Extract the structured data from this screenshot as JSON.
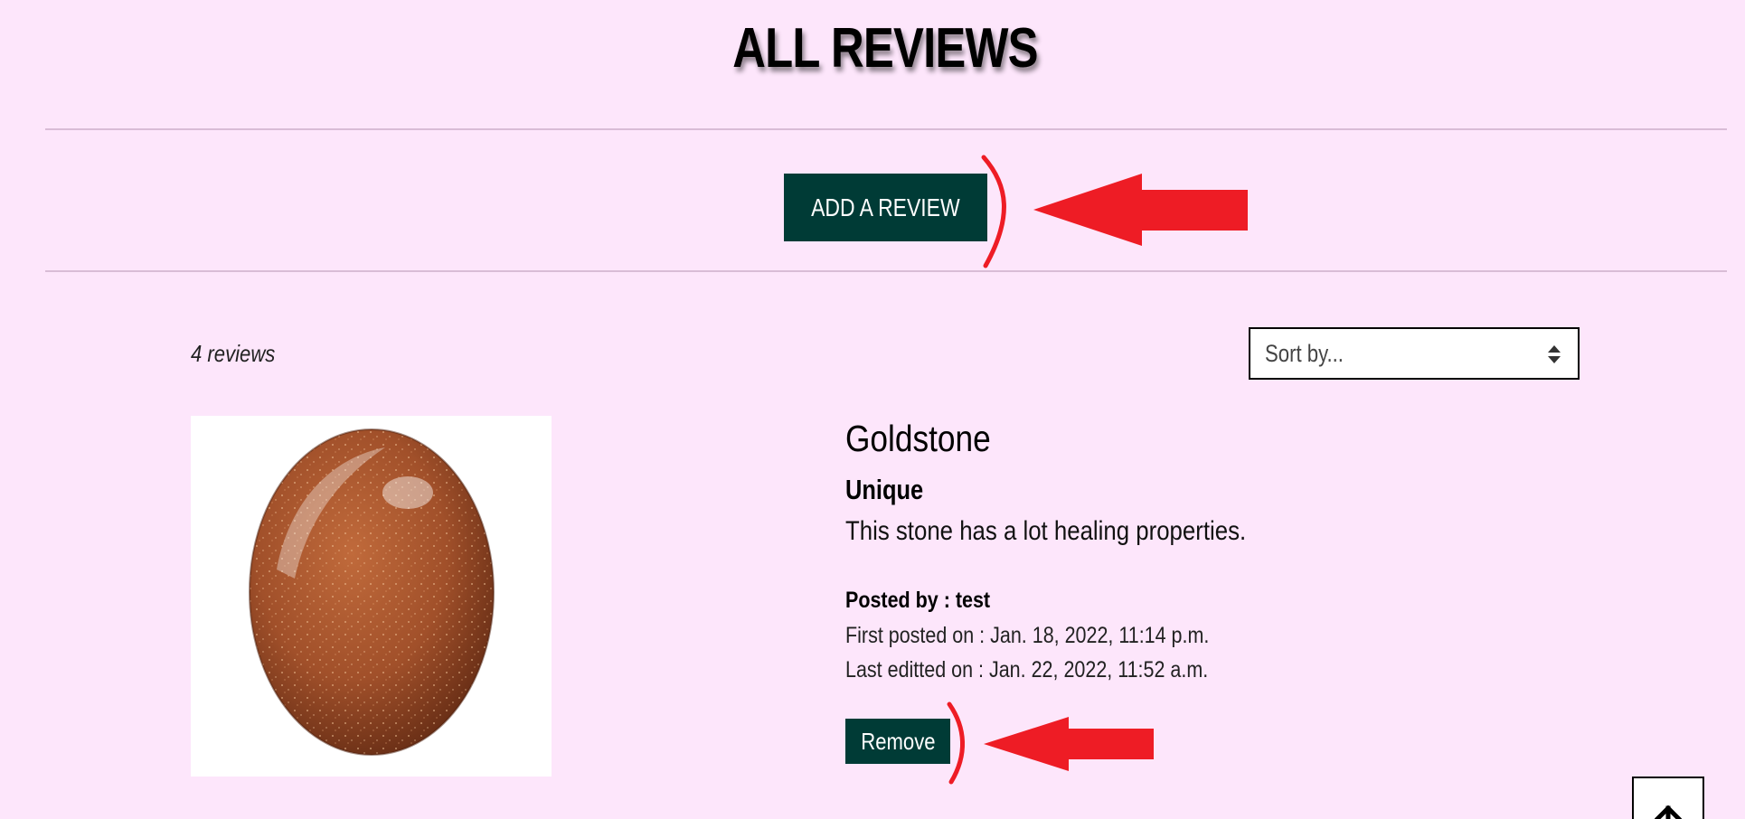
{
  "page": {
    "title": "ALL REVIEWS"
  },
  "actions": {
    "add_review_label": "ADD A REVIEW"
  },
  "list": {
    "count_text": "4 reviews",
    "sort_placeholder": "Sort by..."
  },
  "review": {
    "product_name": "Goldstone",
    "review_title": "Unique",
    "review_body": "This stone has a lot healing properties.",
    "posted_by": "Posted by : test",
    "first_posted": "First posted on : Jan. 18, 2022, 11:14 p.m.",
    "last_edited": "Last editted on : Jan. 22, 2022, 11:52 a.m.",
    "remove_label": "Remove"
  },
  "icons": {
    "sort": "sort-arrows-icon",
    "back_to_top": "arrow-up-icon",
    "annotation_arrow": "red-arrow-annotation"
  },
  "colors": {
    "background": "#fde6fb",
    "button": "#003b36",
    "annotation": "#ee1c25"
  }
}
